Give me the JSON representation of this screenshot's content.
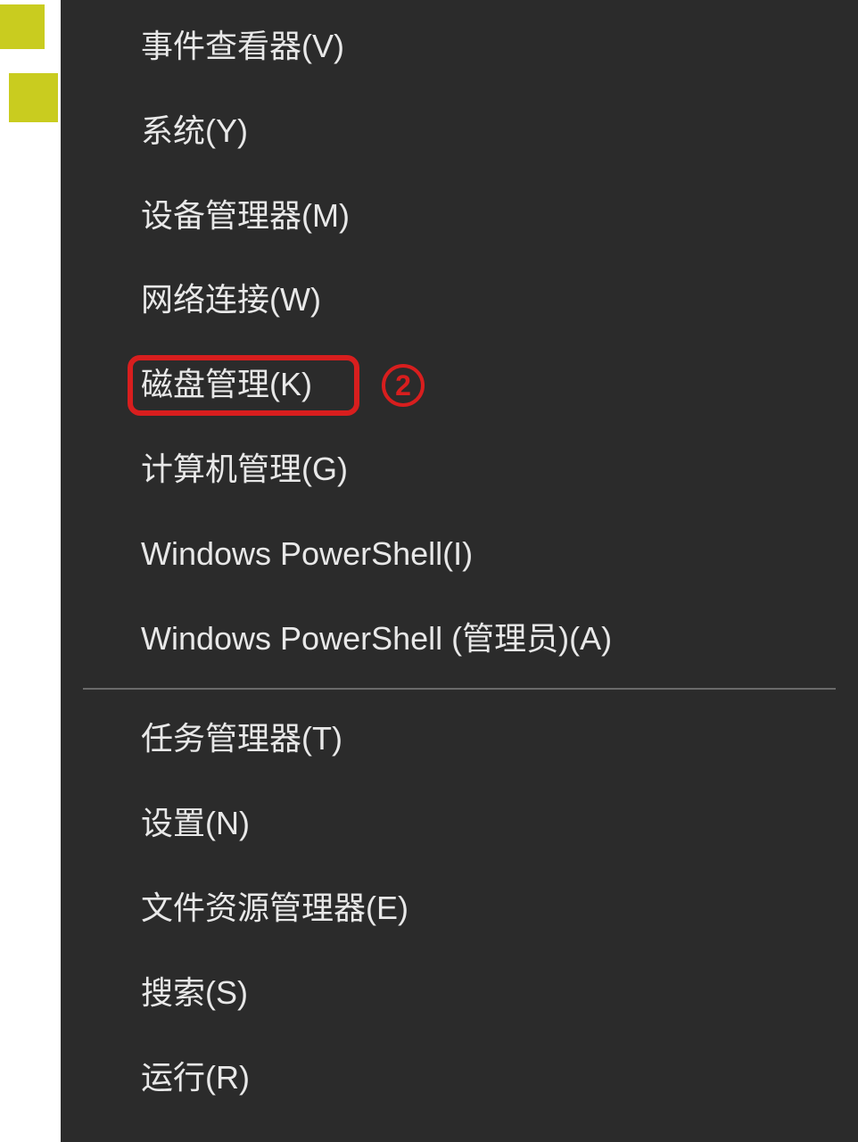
{
  "menu": {
    "items": [
      {
        "label": "事件查看器(V)",
        "name": "menu-item-event-viewer"
      },
      {
        "label": "系统(Y)",
        "name": "menu-item-system"
      },
      {
        "label": "设备管理器(M)",
        "name": "menu-item-device-manager"
      },
      {
        "label": "网络连接(W)",
        "name": "menu-item-network-connections"
      },
      {
        "label": "磁盘管理(K)",
        "name": "menu-item-disk-management",
        "highlighted": true
      },
      {
        "label": "计算机管理(G)",
        "name": "menu-item-computer-management"
      },
      {
        "label": "Windows PowerShell(I)",
        "name": "menu-item-powershell"
      },
      {
        "label": "Windows PowerShell (管理员)(A)",
        "name": "menu-item-powershell-admin"
      },
      {
        "separator": true
      },
      {
        "label": "任务管理器(T)",
        "name": "menu-item-task-manager"
      },
      {
        "label": "设置(N)",
        "name": "menu-item-settings"
      },
      {
        "label": "文件资源管理器(E)",
        "name": "menu-item-file-explorer"
      },
      {
        "label": "搜索(S)",
        "name": "menu-item-search"
      },
      {
        "label": "运行(R)",
        "name": "menu-item-run"
      }
    ]
  },
  "annotation": {
    "number": "2"
  }
}
